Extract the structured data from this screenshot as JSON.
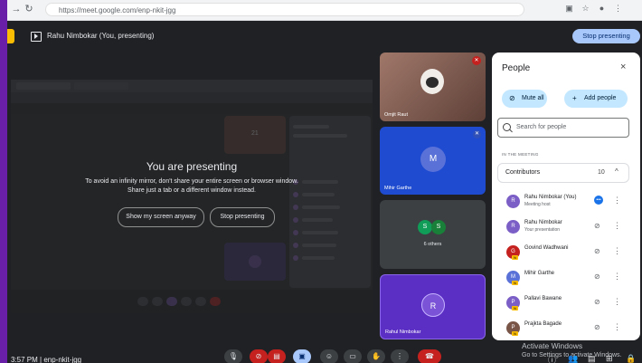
{
  "browser": {
    "url": "https://meet.google.com/enp-nkit-jgg"
  },
  "meet_header": {
    "presenter_title": "Rahu Nimbokar (You, presenting)",
    "stop_button_label": "Stop presenting"
  },
  "presentation": {
    "heading": "You are presenting",
    "warning_line1": "To avoid an infinity mirror, don't share your entire screen or browser window.",
    "warning_line2": "Share just a tab or a different window instead.",
    "show_anyway_label": "Show my screen anyway",
    "stop_label": "Stop presenting"
  },
  "tiles": [
    {
      "name": "Omjit Raut"
    },
    {
      "name": "Mihir Garthe",
      "initial": "M"
    },
    {
      "avatar1": "S",
      "avatar2": "S",
      "label": "6 others"
    },
    {
      "name": "Rahul Nimbokar",
      "initial": "R"
    }
  ],
  "people_panel": {
    "title": "People",
    "close_icon": "×",
    "mute_all_label": "Mute all",
    "add_people_label": "Add people",
    "search_placeholder": "Search for people",
    "section_label": "IN THE MEETING",
    "group_label": "Contributors",
    "group_count": "10",
    "participants": [
      {
        "name": "Rahu Nimbokar (You)",
        "sub": "Meeting host",
        "initial": "R",
        "color": "#7b5ec6"
      },
      {
        "name": "Rahu Nimbokar",
        "sub": "Your presentation",
        "initial": "R",
        "color": "#7b5ec6"
      },
      {
        "name": "Govind Wadhwani",
        "sub": "",
        "initial": "G",
        "color": "#c5221f",
        "badge": "N"
      },
      {
        "name": "Mihir Garthe",
        "sub": "",
        "initial": "M",
        "color": "#5a72d8",
        "badge": "N"
      },
      {
        "name": "Pallavi Bawane",
        "sub": "",
        "initial": "P",
        "color": "#7b5ec6",
        "badge": "N"
      },
      {
        "name": "Prajkta Bagade",
        "sub": "",
        "initial": "P",
        "color": "#795548",
        "badge": "N"
      }
    ]
  },
  "bottom_bar": {
    "time_and_code": "3:57 PM  |  enp-nkit-jgg"
  },
  "watermark": {
    "line1": "Activate Windows",
    "line2": "Go to Settings to activate Windows."
  }
}
